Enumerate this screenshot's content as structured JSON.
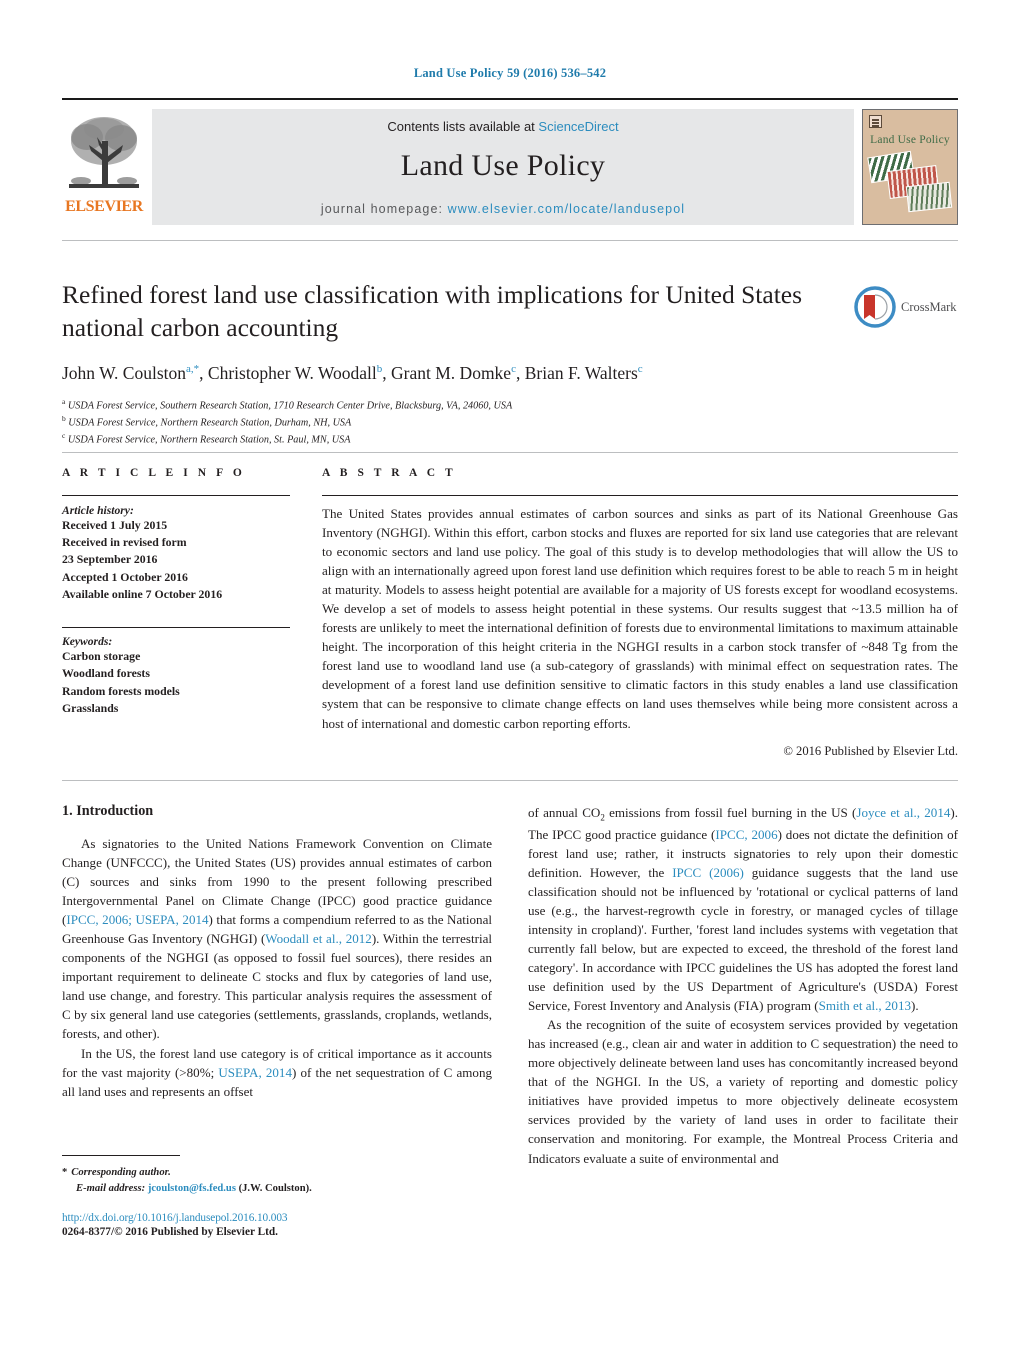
{
  "running_head": "Land Use Policy 59 (2016) 536–542",
  "masthead": {
    "contents_prefix": "Contents lists available at ",
    "sciencedirect": "ScienceDirect",
    "journal_name": "Land Use Policy",
    "homepage_prefix": "journal homepage: ",
    "homepage_url": "www.elsevier.com/locate/landusepol",
    "publisher": "ELSEVIER",
    "cover_title": "Land Use Policy",
    "accent_link": "#2b8cbe",
    "accent_orange": "#e87722",
    "cover_bg": "#d9bda0"
  },
  "article": {
    "title": "Refined forest land use classification with implications for United States national carbon accounting",
    "crossmark_label": "CrossMark",
    "authors": [
      {
        "name": "John W. Coulston",
        "sup": "a,*"
      },
      {
        "name": "Christopher W. Woodall",
        "sup": "b"
      },
      {
        "name": "Grant M. Domke",
        "sup": "c"
      },
      {
        "name": "Brian F. Walters",
        "sup": "c"
      }
    ],
    "affiliations": [
      {
        "marker": "a",
        "text": "USDA Forest Service, Southern Research Station, 1710 Research Center Drive, Blacksburg, VA, 24060, USA"
      },
      {
        "marker": "b",
        "text": "USDA Forest Service, Northern Research Station, Durham, NH, USA"
      },
      {
        "marker": "c",
        "text": "USDA Forest Service, Northern Research Station, St. Paul, MN, USA"
      }
    ]
  },
  "article_info": {
    "label": "A R T I C L E   I N F O",
    "history_head": "Article history:",
    "history": [
      "Received 1 July 2015",
      "Received in revised form",
      "23 September 2016",
      "Accepted 1 October 2016",
      "Available online 7 October 2016"
    ],
    "keywords_head": "Keywords:",
    "keywords": [
      "Carbon storage",
      "Woodland forests",
      "Random forests models",
      "Grasslands"
    ]
  },
  "abstract": {
    "label": "A B S T R A C T",
    "text": "The United States provides annual estimates of carbon sources and sinks as part of its National Greenhouse Gas Inventory (NGHGI). Within this effort, carbon stocks and fluxes are reported for six land use categories that are relevant to economic sectors and land use policy. The goal of this study is to develop methodologies that will allow the US to align with an internationally agreed upon forest land use definition which requires forest to be able to reach 5 m in height at maturity. Models to assess height potential are available for a majority of US forests except for woodland ecosystems. We develop a set of models to assess height potential in these systems. Our results suggest that ~13.5 million ha of forests are unlikely to meet the international definition of forests due to environmental limitations to maximum attainable height. The incorporation of this height criteria in the NGHGI results in a carbon stock transfer of ~848 Tg from the forest land use to woodland land use (a sub-category of grasslands) with minimal effect on sequestration rates. The development of a forest land use definition sensitive to climatic factors in this study enables a land use classification system that can be responsive to climate change effects on land uses themselves while being more consistent across a host of international and domestic carbon reporting efforts.",
    "copyright": "© 2016 Published by Elsevier Ltd."
  },
  "body": {
    "section_title": "1.  Introduction",
    "left_paragraph_1_a": "As signatories to the United Nations Framework Convention on Climate Change (UNFCCC), the United States (US) provides annual estimates of carbon (C) sources and sinks from 1990 to the present following prescribed Intergovernmental Panel on Climate Change (IPCC) good practice guidance (",
    "left_cite_1": "IPCC, 2006; USEPA, 2014",
    "left_paragraph_1_b": ") that forms a compendium referred to as the National Greenhouse Gas Inventory (NGHGI) (",
    "left_cite_2": "Woodall et al., 2012",
    "left_paragraph_1_c": "). Within the terrestrial components of the NGHGI (as opposed to fossil fuel sources), there resides an important requirement to delineate C stocks and flux by categories of land use, land use change, and forestry. This particular analysis requires the assessment of C by six general land use categories (settlements, grasslands, croplands, wetlands, forests, and other).",
    "left_paragraph_2_a": "In the US, the forest land use category is of critical importance as it accounts for the vast majority (>80%; ",
    "left_cite_3": "USEPA, 2014",
    "left_paragraph_2_b": ") of the net sequestration of C among all land uses and represents an offset",
    "right_paragraph_1_a": "of annual CO",
    "right_paragraph_1_sub": "2",
    "right_paragraph_1_b": " emissions from fossil fuel burning in the US (",
    "right_cite_1": "Joyce et al., 2014",
    "right_paragraph_1_c": "). The IPCC good practice guidance (",
    "right_cite_2": "IPCC, 2006",
    "right_paragraph_1_d": ") does not dictate the definition of forest land use; rather, it instructs signatories to rely upon their domestic definition. However, the ",
    "right_cite_3": "IPCC (2006)",
    "right_paragraph_1_e": " guidance suggests that the land use classification should not be influenced by 'rotational or cyclical patterns of land use (e.g., the harvest-regrowth cycle in forestry, or managed cycles of tillage intensity in cropland)'. Further, 'forest land includes systems with vegetation that currently fall below, but are expected to exceed, the threshold of the forest land category'. In accordance with IPCC guidelines the US has adopted the forest land use definition used by the US Department of Agriculture's (USDA) Forest Service, Forest Inventory and Analysis (FIA) program (",
    "right_cite_4": "Smith et al., 2013",
    "right_paragraph_1_f": ").",
    "right_paragraph_2": "As the recognition of the suite of ecosystem services provided by vegetation has increased (e.g., clean air and water in addition to C sequestration) the need to more objectively delineate between land uses has concomitantly increased beyond that of the NGHGI. In the US, a variety of reporting and domestic policy initiatives have provided impetus to more objectively delineate ecosystem services provided by the variety of land uses in order to facilitate their conservation and monitoring. For example, the Montreal Process Criteria and Indicators evaluate a suite of environmental and"
  },
  "footnote": {
    "corresponding": "Corresponding author.",
    "email_label": "E-mail address:",
    "email": "jcoulston@fs.fed.us",
    "email_owner": "(J.W. Coulston)."
  },
  "footer": {
    "doi": "http://dx.doi.org/10.1016/j.landusepol.2016.10.003",
    "issn": "0264-8377/© 2016 Published by Elsevier Ltd."
  }
}
